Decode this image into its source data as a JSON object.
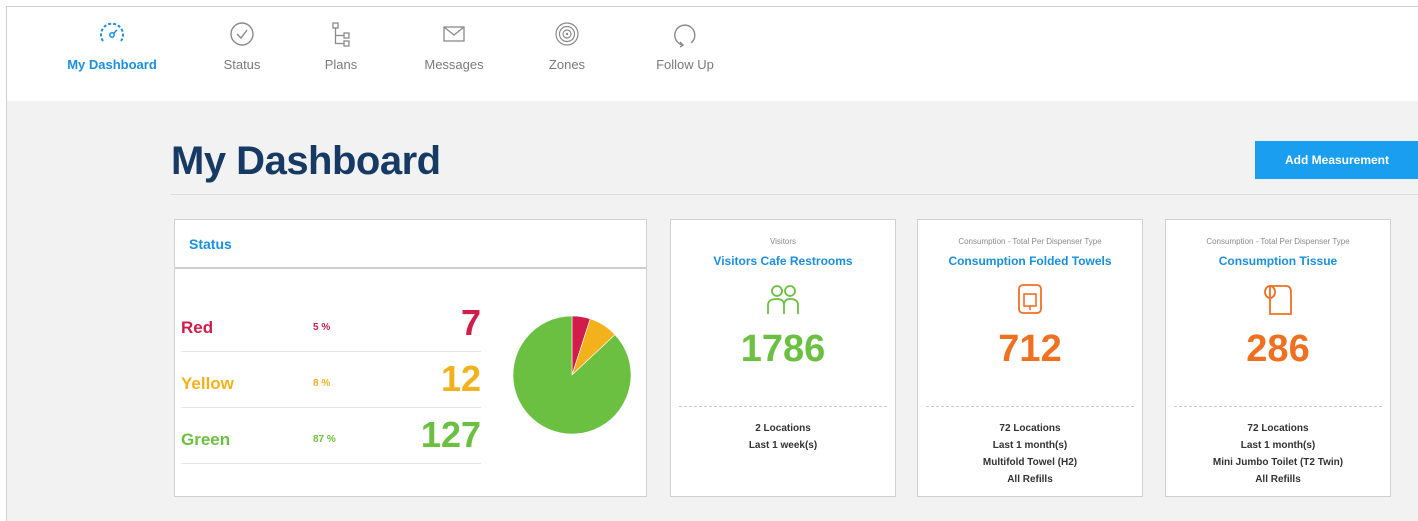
{
  "nav": {
    "items": [
      {
        "label": "My Dashboard",
        "icon": "speedometer-icon",
        "active": true
      },
      {
        "label": "Status",
        "icon": "check-circle-icon",
        "active": false
      },
      {
        "label": "Plans",
        "icon": "hierarchy-icon",
        "active": false
      },
      {
        "label": "Messages",
        "icon": "envelope-icon",
        "active": false
      },
      {
        "label": "Zones",
        "icon": "target-icon",
        "active": false
      },
      {
        "label": "Follow Up",
        "icon": "refresh-icon",
        "active": false
      }
    ]
  },
  "header": {
    "title": "My Dashboard",
    "add_button_label": "Add Measurement"
  },
  "status": {
    "title": "Status",
    "rows": [
      {
        "name": "Red",
        "percent": "5 %",
        "count": "7",
        "color": "#d01d4c"
      },
      {
        "name": "Yellow",
        "percent": "8 %",
        "count": "12",
        "color": "#f3b21b"
      },
      {
        "name": "Green",
        "percent": "87 %",
        "count": "127",
        "color": "#6cc041"
      }
    ],
    "pie_fractions": [
      0.05,
      0.08,
      0.87
    ]
  },
  "cards": [
    {
      "category": "Visitors",
      "title": "Visitors Cafe Restrooms",
      "icon": "people-icon",
      "value": "1786",
      "value_color": "#6cc041",
      "details": [
        "2 Locations",
        "Last 1 week(s)"
      ]
    },
    {
      "category": "Consumption - Total Per Dispenser Type",
      "title": "Consumption Folded Towels",
      "icon": "towel-dispenser-icon",
      "value": "712",
      "value_color": "#f07022",
      "details": [
        "72 Locations",
        "Last 1 month(s)",
        "Multifold Towel (H2)",
        "All Refills"
      ]
    },
    {
      "category": "Consumption - Total Per Dispenser Type",
      "title": "Consumption Tissue",
      "icon": "toilet-roll-icon",
      "value": "286",
      "value_color": "#f07022",
      "details": [
        "72 Locations",
        "Last 1 month(s)",
        "Mini Jumbo Toilet (T2 Twin)",
        "All Refills"
      ]
    }
  ]
}
